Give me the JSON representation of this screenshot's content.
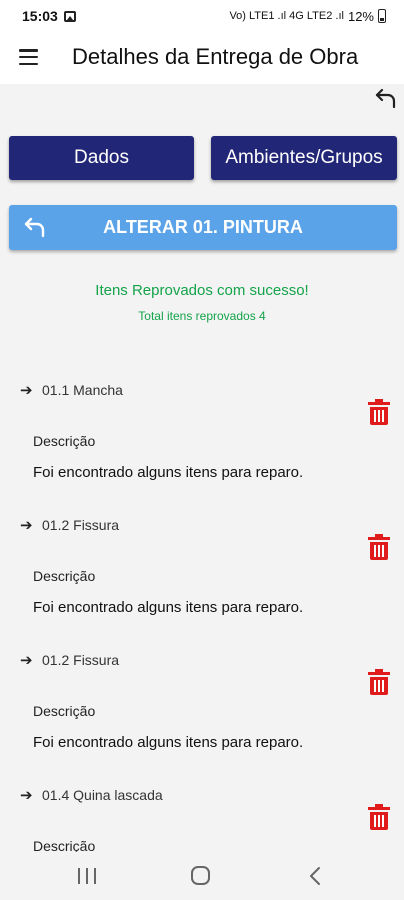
{
  "status_bar": {
    "time": "15:03",
    "signal_text": "Vo) LTE1 .ıl 4G LTE2 .ıl",
    "battery": "12%"
  },
  "app_bar": {
    "title": "Detalhes da Entrega de Obra",
    "menu_icon": "hamburger-menu-icon"
  },
  "buttons": {
    "dados": "Dados",
    "ambientes": "Ambientes/Grupos"
  },
  "alter_bar": {
    "label": "ALTERAR 01. PINTURA"
  },
  "messages": {
    "success": "Itens Reprovados com sucesso!",
    "total": "Total itens reprovados 4"
  },
  "items": [
    {
      "code": "01.1 Mancha",
      "desc_label": "Descrição",
      "desc": "Foi encontrado alguns itens para reparo."
    },
    {
      "code": "01.2 Fissura",
      "desc_label": "Descrição",
      "desc": "Foi encontrado alguns itens para reparo."
    },
    {
      "code": "01.2 Fissura",
      "desc_label": "Descrição",
      "desc": "Foi encontrado alguns itens para reparo."
    },
    {
      "code": "01.4 Quina lascada",
      "desc_label": "Descrição",
      "desc": ""
    }
  ],
  "colors": {
    "primary_dark": "#222677",
    "accent_blue": "#5aa3e9",
    "success_green": "#14a34a",
    "delete_red": "#e01b1b"
  }
}
